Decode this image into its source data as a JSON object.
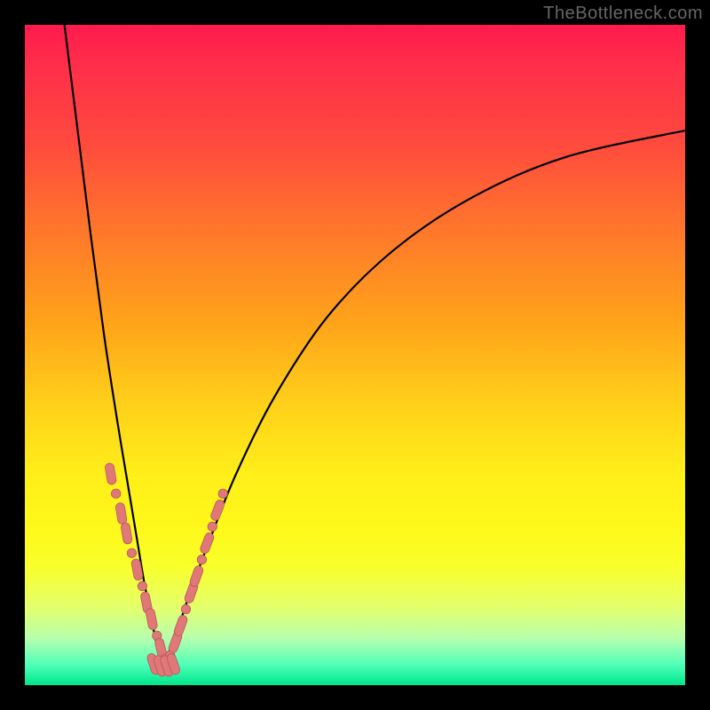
{
  "watermark": "TheBottleneck.com",
  "colors": {
    "gradient_top": "#ff1a4d",
    "gradient_mid": "#ffd21a",
    "gradient_bottom": "#00e68a",
    "curve": "#000000",
    "bead_fill": "#e07878",
    "bead_stroke": "#b25a5a",
    "frame": "#000000"
  },
  "chart_data": {
    "type": "line",
    "title": "",
    "xlabel": "",
    "ylabel": "",
    "xlim": [
      0,
      100
    ],
    "ylim": [
      0,
      100
    ],
    "grid": false,
    "legend": false,
    "note": "Two curves descend into a sharp V near x≈21 and rejoin near the bottom; vertical gradient encodes a red→green scale with green at the bottom.",
    "series": [
      {
        "name": "left-curve",
        "x": [
          6,
          8,
          10,
          12,
          14,
          16,
          17,
          18,
          19,
          20,
          21
        ],
        "y": [
          100,
          84,
          68,
          53,
          40,
          28,
          22,
          16,
          11,
          6,
          3
        ]
      },
      {
        "name": "right-curve",
        "x": [
          21,
          23,
          25,
          28,
          32,
          38,
          46,
          56,
          68,
          82,
          100
        ],
        "y": [
          3,
          8,
          14,
          22,
          32,
          44,
          56,
          66,
          74,
          80,
          84
        ]
      },
      {
        "name": "beads-left",
        "comment": "salmon markers clustered on lower-left arm",
        "x": [
          13.0,
          13.8,
          14.6,
          15.4,
          16.2,
          17.0,
          17.8,
          18.4,
          19.2,
          20.0,
          20.6,
          21.2
        ],
        "y": [
          32,
          29,
          26,
          23,
          20,
          17.5,
          15,
          12.5,
          10,
          7.5,
          5.5,
          4
        ]
      },
      {
        "name": "beads-right",
        "comment": "salmon markers clustered on lower-right arm",
        "x": [
          22.0,
          22.8,
          23.6,
          24.4,
          25.2,
          26.0,
          26.8,
          27.6,
          28.4,
          29.2,
          30.0
        ],
        "y": [
          4.5,
          6.5,
          9,
          11.5,
          14,
          16.5,
          19,
          21.5,
          24,
          26.5,
          29
        ]
      },
      {
        "name": "beads-bottom",
        "comment": "salmon markers along the trough",
        "x": [
          19.5,
          20.5,
          21.5,
          22.5
        ],
        "y": [
          3.2,
          2.9,
          2.9,
          3.2
        ]
      }
    ]
  }
}
